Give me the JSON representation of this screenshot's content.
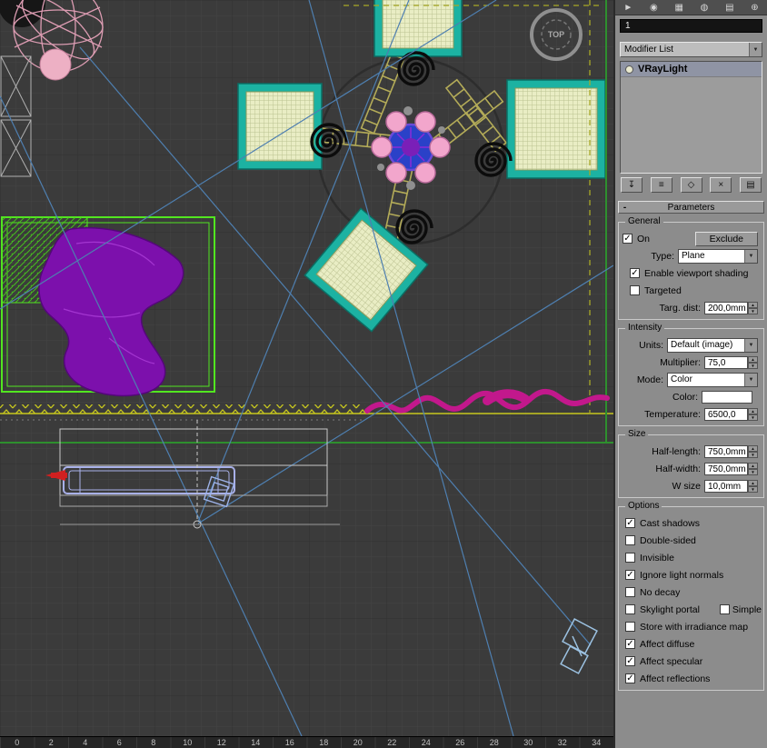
{
  "icons": {
    "check": "✓",
    "dropdown": "▼",
    "spin_up": "▲",
    "spin_down": "▼",
    "collapse_minus": "-",
    "panel_tabs": [
      "►",
      "◉",
      "▦",
      "◍",
      "▤",
      "⊕"
    ],
    "stack_buttons": [
      "↧",
      "≡",
      "◇",
      "×",
      "▤"
    ]
  },
  "viewport": {
    "view_label": "TOP",
    "timeline_ticks": [
      "0",
      "2",
      "4",
      "6",
      "8",
      "10",
      "12",
      "14",
      "16",
      "18",
      "20",
      "22",
      "24",
      "26",
      "28",
      "30",
      "32",
      "34"
    ]
  },
  "panel": {
    "object_name": "1",
    "modifier_list_label": "Modifier List",
    "modifier_stack": [
      {
        "label": "VRayLight",
        "selected": true
      }
    ],
    "rollout_title": "Parameters",
    "groups": {
      "general": {
        "title": "General",
        "on_label": "On",
        "exclude_button": "Exclude",
        "type_label": "Type:",
        "type_value": "Plane",
        "enable_viewport_shading_label": "Enable viewport shading",
        "targeted_label": "Targeted",
        "targ_dist_label": "Targ. dist:",
        "targ_dist_value": "200,0mm"
      },
      "intensity": {
        "title": "Intensity",
        "units_label": "Units:",
        "units_value": "Default (image)",
        "multiplier_label": "Multiplier:",
        "multiplier_value": "75,0",
        "mode_label": "Mode:",
        "mode_value": "Color",
        "color_label": "Color:",
        "color_swatch": "#ffffff",
        "temperature_label": "Temperature:",
        "temperature_value": "6500,0"
      },
      "size": {
        "title": "Size",
        "half_length_label": "Half-length:",
        "half_length_value": "750,0mm",
        "half_width_label": "Half-width:",
        "half_width_value": "750,0mm",
        "w_size_label": "W size",
        "w_size_value": "10,0mm"
      },
      "options": {
        "title": "Options",
        "items": [
          {
            "label": "Cast shadows",
            "checked": true
          },
          {
            "label": "Double-sided",
            "checked": false
          },
          {
            "label": "Invisible",
            "checked": false
          },
          {
            "label": "Ignore light normals",
            "checked": true
          },
          {
            "label": "No decay",
            "checked": false
          },
          {
            "label": "Skylight portal",
            "checked": false
          },
          {
            "label": "Simple",
            "checked": false
          },
          {
            "label": "Store with irradiance map",
            "checked": false
          },
          {
            "label": "Affect diffuse",
            "checked": true
          },
          {
            "label": "Affect specular",
            "checked": true
          },
          {
            "label": "Affect reflections",
            "checked": true
          }
        ]
      }
    }
  },
  "colors": {
    "viewport_bg": "#3b3b3b",
    "grid_line": "#444444",
    "chair_teal": "#1cb2a2",
    "seat_weave": "#e9edc4",
    "light_plane_green": "#52e620",
    "curtain_magenta": "#c2188c",
    "drape_purple": "#7c10ac",
    "table_blue": "#2a41c8",
    "flower_pink": "#f2a6cc",
    "gizmo_yellow": "#c8c81e",
    "target_line_blue": "#4e7fb0",
    "panel_bg": "#8c8c8c"
  }
}
